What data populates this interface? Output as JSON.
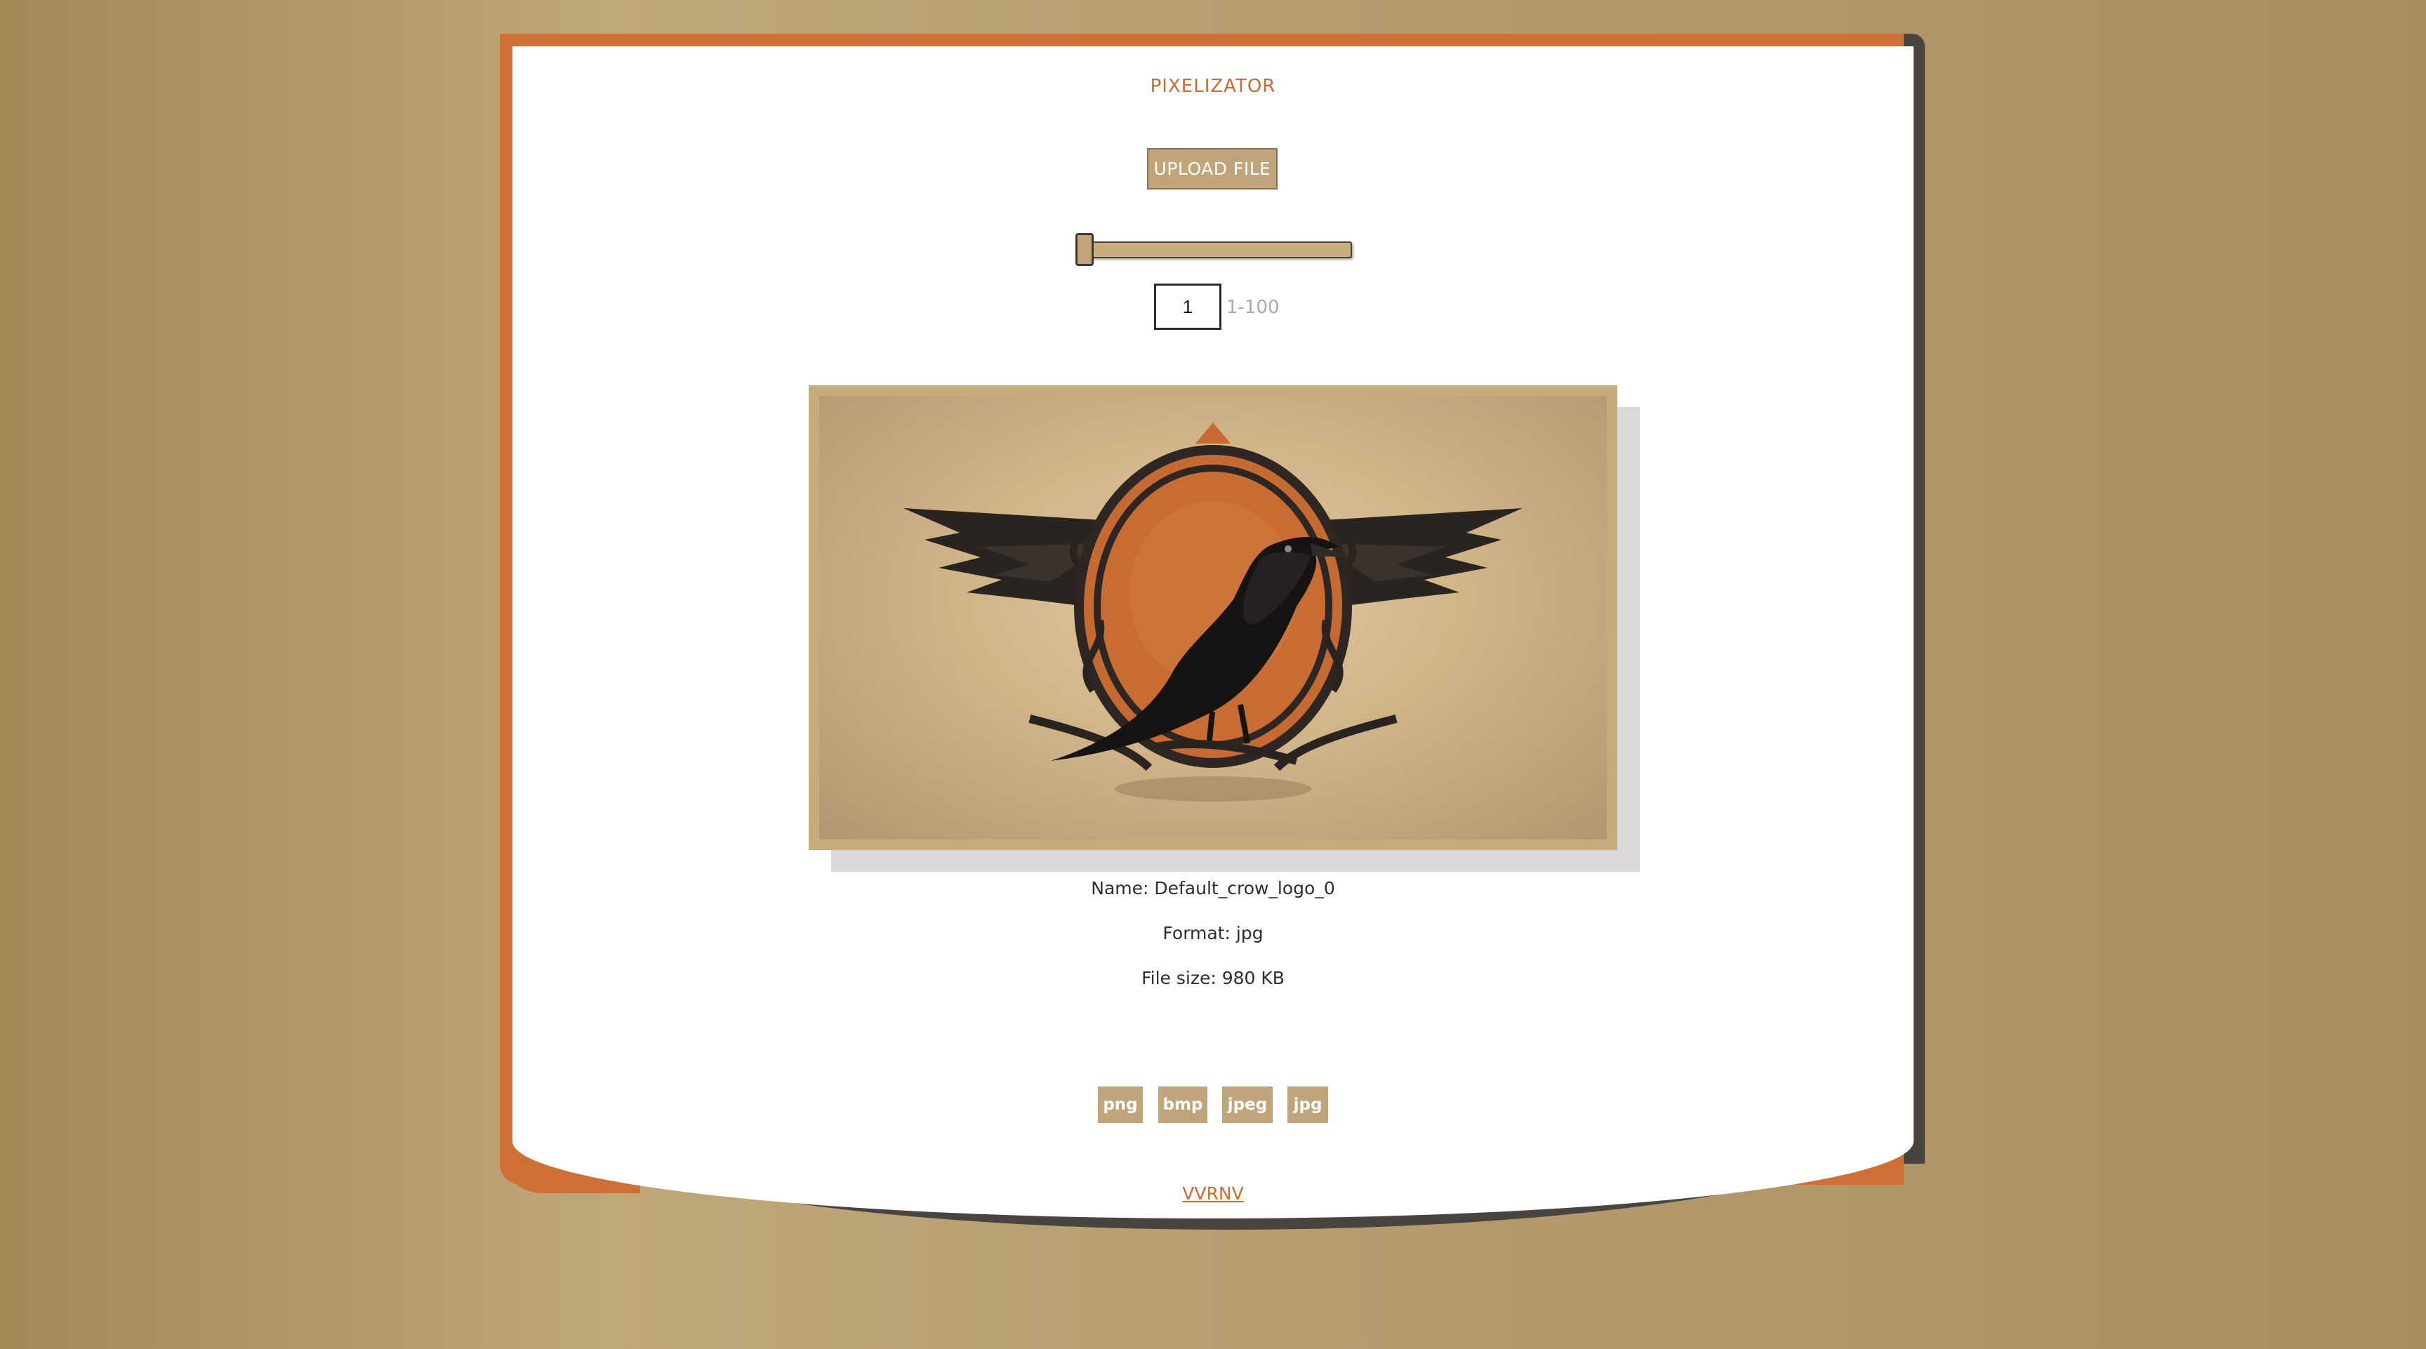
{
  "app": {
    "title": "PIXELIZATOR"
  },
  "upload": {
    "label": "UPLOAD FILE"
  },
  "pixel_size": {
    "value": "1",
    "range_hint": "1-100",
    "slider_level": 0.01
  },
  "image": {
    "alt": "Crow logo image",
    "icon": "crow-emblem-image"
  },
  "file_info": {
    "name_text": "Name: Default_crow_logo_0",
    "format_text": "Format: jpg",
    "size_text": "File size: 980 KB"
  },
  "formats": [
    "png",
    "bmp",
    "jpeg",
    "jpg"
  ],
  "footer": {
    "link_text": "VVRNV"
  },
  "colors": {
    "accent": "#cf6f36",
    "button": "#bfa579",
    "background": "#b59d70"
  }
}
